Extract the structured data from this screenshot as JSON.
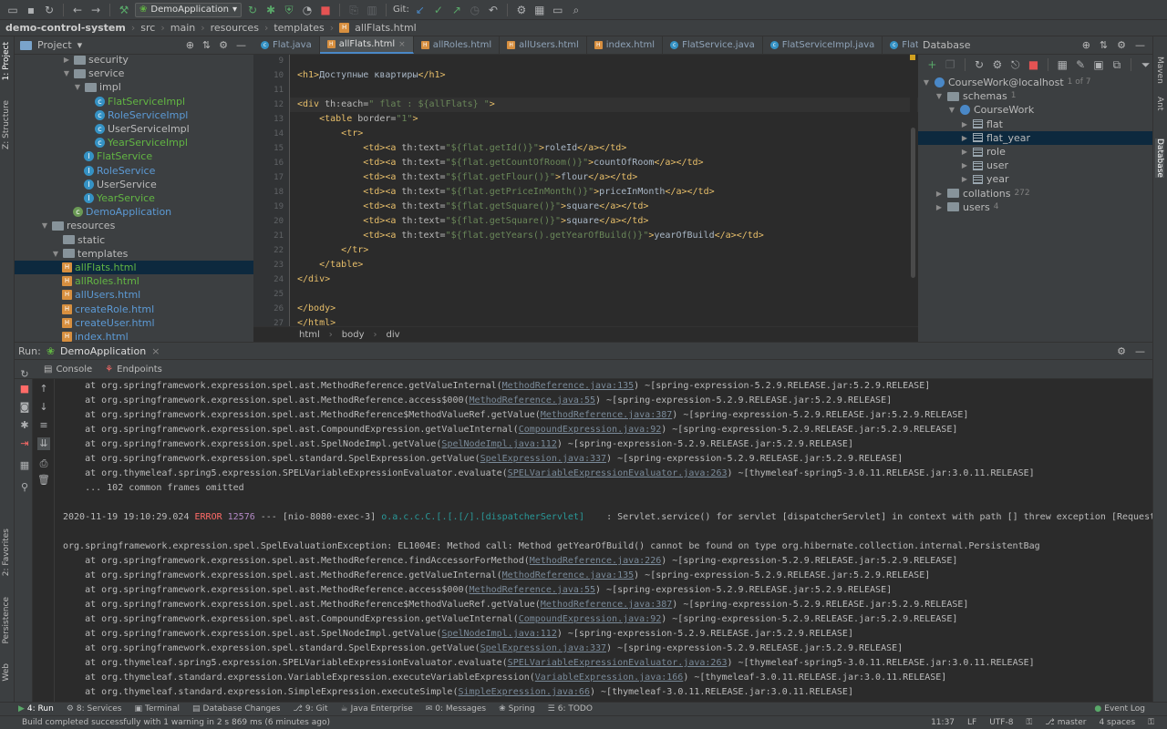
{
  "toolbar": {
    "run_config": "DemoApplication",
    "git_label": "Git:"
  },
  "breadcrumbs": [
    "demo-control-system",
    "src",
    "main",
    "resources",
    "templates",
    "allFlats.html"
  ],
  "left_strip": {
    "project": "1: Project",
    "structure": "Z: Structure",
    "favorites": "2: Favorites",
    "persistence": "Persistence",
    "web": "Web"
  },
  "right_strip": {
    "maven": "Maven",
    "ant": "Ant",
    "database": "Database"
  },
  "project": {
    "title": "Project",
    "tree": [
      {
        "label": "security",
        "kind": "folder",
        "indent": 4,
        "arrow": "▶"
      },
      {
        "label": "service",
        "kind": "folder",
        "indent": 4,
        "arrow": "▼"
      },
      {
        "label": "impl",
        "kind": "folder",
        "indent": 5,
        "arrow": "▼"
      },
      {
        "label": "FlatServiceImpl",
        "kind": "class",
        "indent": 7,
        "color": "g"
      },
      {
        "label": "RoleServiceImpl",
        "kind": "class",
        "indent": 7,
        "color": "b"
      },
      {
        "label": "UserServiceImpl",
        "kind": "class",
        "indent": 7,
        "color": ""
      },
      {
        "label": "YearServiceImpl",
        "kind": "class",
        "indent": 7,
        "color": "g"
      },
      {
        "label": "FlatService",
        "kind": "iface",
        "indent": 6,
        "color": "g"
      },
      {
        "label": "RoleService",
        "kind": "iface",
        "indent": 6,
        "color": "b"
      },
      {
        "label": "UserService",
        "kind": "iface",
        "indent": 6,
        "color": ""
      },
      {
        "label": "YearService",
        "kind": "iface",
        "indent": 6,
        "color": "g"
      },
      {
        "label": "DemoApplication",
        "kind": "spring",
        "indent": 5,
        "color": "b"
      },
      {
        "label": "resources",
        "kind": "folder",
        "indent": 2,
        "arrow": "▼"
      },
      {
        "label": "static",
        "kind": "folder",
        "indent": 3,
        "arrow": ""
      },
      {
        "label": "templates",
        "kind": "folder",
        "indent": 3,
        "arrow": "▼"
      },
      {
        "label": "allFlats.html",
        "kind": "html",
        "indent": 4,
        "color": "g",
        "selected": true
      },
      {
        "label": "allRoles.html",
        "kind": "html",
        "indent": 4,
        "color": "g"
      },
      {
        "label": "allUsers.html",
        "kind": "html",
        "indent": 4,
        "color": "b"
      },
      {
        "label": "createRole.html",
        "kind": "html",
        "indent": 4,
        "color": "b"
      },
      {
        "label": "createUser.html",
        "kind": "html",
        "indent": 4,
        "color": "b"
      },
      {
        "label": "index.html",
        "kind": "html",
        "indent": 4,
        "color": "b"
      }
    ]
  },
  "editor_tabs": [
    {
      "label": "Flat.java",
      "type": "class"
    },
    {
      "label": "allFlats.html",
      "type": "html",
      "active": true
    },
    {
      "label": "allRoles.html",
      "type": "html"
    },
    {
      "label": "allUsers.html",
      "type": "html"
    },
    {
      "label": "index.html",
      "type": "html"
    },
    {
      "label": "FlatService.java",
      "type": "class"
    },
    {
      "label": "FlatServiceImpl.java",
      "type": "class"
    },
    {
      "label": "FlatController.ja",
      "type": "class"
    }
  ],
  "editor": {
    "lines": [
      {
        "n": "9",
        "html": ""
      },
      {
        "n": "10",
        "html": "<span class=\"tg\">&lt;h1&gt;</span>Доступные квартиры<span class=\"tg\">&lt;/h1&gt;</span>"
      },
      {
        "n": "11",
        "html": ""
      },
      {
        "n": "12",
        "html": "<span class=\"tg\">&lt;div </span><span class=\"at\">th:each=</span><span class=\"av\">\" flat : ${allFlats} \"</span><span class=\"tg\">&gt;</span>",
        "current": true
      },
      {
        "n": "13",
        "html": "    <span class=\"tg\">&lt;table </span><span class=\"at\">border=</span><span class=\"av\">\"1\"</span><span class=\"tg\">&gt;</span>"
      },
      {
        "n": "14",
        "html": "        <span class=\"tg\">&lt;tr&gt;</span>"
      },
      {
        "n": "15",
        "html": "            <span class=\"tg\">&lt;td&gt;&lt;a </span><span class=\"at\">th:text=</span><span class=\"av\">\"${flat.getId()}\"</span><span class=\"tg\">&gt;</span>roleId<span class=\"tg\">&lt;/a&gt;&lt;/td&gt;</span>"
      },
      {
        "n": "16",
        "html": "            <span class=\"tg\">&lt;td&gt;&lt;a </span><span class=\"at\">th:text=</span><span class=\"av\">\"${flat.getCountOfRoom()}\"</span><span class=\"tg\">&gt;</span>countOfRoom<span class=\"tg\">&lt;/a&gt;&lt;/td&gt;</span>"
      },
      {
        "n": "17",
        "html": "            <span class=\"tg\">&lt;td&gt;&lt;a </span><span class=\"at\">th:text=</span><span class=\"av\">\"${flat.getFlour()}\"</span><span class=\"tg\">&gt;</span>flour<span class=\"tg\">&lt;/a&gt;&lt;/td&gt;</span>"
      },
      {
        "n": "18",
        "html": "            <span class=\"tg\">&lt;td&gt;&lt;a </span><span class=\"at\">th:text=</span><span class=\"av\">\"${flat.getPriceInMonth()}\"</span><span class=\"tg\">&gt;</span>priceInMonth<span class=\"tg\">&lt;/a&gt;&lt;/td&gt;</span>"
      },
      {
        "n": "19",
        "html": "            <span class=\"tg\">&lt;td&gt;&lt;a </span><span class=\"at\">th:text=</span><span class=\"av\">\"${flat.getSquare()}\"</span><span class=\"tg\">&gt;</span>square<span class=\"tg\">&lt;/a&gt;&lt;/td&gt;</span>"
      },
      {
        "n": "20",
        "html": "            <span class=\"tg\">&lt;td&gt;&lt;a </span><span class=\"at\">th:text=</span><span class=\"av\">\"${flat.getSquare()}\"</span><span class=\"tg\">&gt;</span>square<span class=\"tg\">&lt;/a&gt;&lt;/td&gt;</span>"
      },
      {
        "n": "21",
        "html": "            <span class=\"tg\">&lt;td&gt;&lt;a </span><span class=\"at\">th:text=</span><span class=\"av\">\"${flat.getYears().getYearOfBuild()}\"</span><span class=\"tg\">&gt;</span>yearOfBuild<span class=\"tg\">&lt;/a&gt;&lt;/td&gt;</span>"
      },
      {
        "n": "22",
        "html": "        <span class=\"tg\">&lt;/tr&gt;</span>"
      },
      {
        "n": "23",
        "html": "    <span class=\"tg\">&lt;/table&gt;</span>"
      },
      {
        "n": "24",
        "html": "<span class=\"tg\">&lt;/div&gt;</span>"
      },
      {
        "n": "25",
        "html": ""
      },
      {
        "n": "26",
        "html": "<span class=\"tg\">&lt;/body&gt;</span>"
      },
      {
        "n": "27",
        "html": "<span class=\"tg\">&lt;/html&gt;</span>"
      }
    ],
    "path": [
      "html",
      "body",
      "div"
    ]
  },
  "database": {
    "title": "Database",
    "tree": [
      {
        "label": "CourseWork@localhost",
        "count": "1 of 7",
        "kind": "db",
        "indent": 0,
        "arrow": "▼"
      },
      {
        "label": "schemas",
        "count": "1",
        "kind": "folder",
        "indent": 1,
        "arrow": "▼"
      },
      {
        "label": "CourseWork",
        "count": "",
        "kind": "schema",
        "indent": 2,
        "arrow": "▼"
      },
      {
        "label": "flat",
        "count": "",
        "kind": "table",
        "indent": 3,
        "arrow": "▶"
      },
      {
        "label": "flat_year",
        "count": "",
        "kind": "table",
        "indent": 3,
        "arrow": "▶",
        "selected": true
      },
      {
        "label": "role",
        "count": "",
        "kind": "table",
        "indent": 3,
        "arrow": "▶"
      },
      {
        "label": "user",
        "count": "",
        "kind": "table",
        "indent": 3,
        "arrow": "▶"
      },
      {
        "label": "year",
        "count": "",
        "kind": "table",
        "indent": 3,
        "arrow": "▶"
      },
      {
        "label": "collations",
        "count": "272",
        "kind": "folder",
        "indent": 1,
        "arrow": "▶"
      },
      {
        "label": "users",
        "count": "4",
        "kind": "folder",
        "indent": 1,
        "arrow": "▶"
      }
    ]
  },
  "run": {
    "label": "Run:",
    "config": "DemoApplication",
    "tabs": [
      "Console",
      "Endpoints"
    ]
  },
  "console": {
    "lines": [
      {
        "pre": "    at org.springframework.expression.spel.ast.MethodReference.getValueInternal(",
        "link": "MethodReference.java:135",
        "post": ") ~[spring-expression-5.2.9.RELEASE.jar:5.2.9.RELEASE]"
      },
      {
        "pre": "    at org.springframework.expression.spel.ast.MethodReference.access$000(",
        "link": "MethodReference.java:55",
        "post": ") ~[spring-expression-5.2.9.RELEASE.jar:5.2.9.RELEASE]"
      },
      {
        "pre": "    at org.springframework.expression.spel.ast.MethodReference$MethodValueRef.getValue(",
        "link": "MethodReference.java:387",
        "post": ") ~[spring-expression-5.2.9.RELEASE.jar:5.2.9.RELEASE]"
      },
      {
        "pre": "    at org.springframework.expression.spel.ast.CompoundExpression.getValueInternal(",
        "link": "CompoundExpression.java:92",
        "post": ") ~[spring-expression-5.2.9.RELEASE.jar:5.2.9.RELEASE]"
      },
      {
        "pre": "    at org.springframework.expression.spel.ast.SpelNodeImpl.getValue(",
        "link": "SpelNodeImpl.java:112",
        "post": ") ~[spring-expression-5.2.9.RELEASE.jar:5.2.9.RELEASE]"
      },
      {
        "pre": "    at org.springframework.expression.spel.standard.SpelExpression.getValue(",
        "link": "SpelExpression.java:337",
        "post": ") ~[spring-expression-5.2.9.RELEASE.jar:5.2.9.RELEASE]"
      },
      {
        "pre": "    at org.thymeleaf.spring5.expression.SPELVariableExpressionEvaluator.evaluate(",
        "link": "SPELVariableExpressionEvaluator.java:263",
        "post": ") ~[thymeleaf-spring5-3.0.11.RELEASE.jar:3.0.11.RELEASE]"
      },
      {
        "pre": "    ... 102 common frames omitted",
        "link": "",
        "post": ""
      },
      {
        "pre": "",
        "link": "",
        "post": ""
      },
      {
        "type": "log",
        "time": "2020-11-19 19:10:29.024",
        "level": "ERROR",
        "pid": "12576",
        "sep": " --- [nio-8080-exec-3] ",
        "cat": "o.a.c.c.C.[.[.[/].[dispatcherServlet]",
        "msg": "    : Servlet.service() for servlet [dispatcherServlet] in context with path [] threw exception [Request processing failed"
      },
      {
        "pre": "",
        "link": "",
        "post": ""
      },
      {
        "pre": "org.springframework.expression.spel.SpelEvaluationException: EL1004E: Method call: Method getYearOfBuild() cannot be found on type org.hibernate.collection.internal.PersistentBag",
        "link": "",
        "post": ""
      },
      {
        "pre": "    at org.springframework.expression.spel.ast.MethodReference.findAccessorForMethod(",
        "link": "MethodReference.java:226",
        "post": ") ~[spring-expression-5.2.9.RELEASE.jar:5.2.9.RELEASE]"
      },
      {
        "pre": "    at org.springframework.expression.spel.ast.MethodReference.getValueInternal(",
        "link": "MethodReference.java:135",
        "post": ") ~[spring-expression-5.2.9.RELEASE.jar:5.2.9.RELEASE]"
      },
      {
        "pre": "    at org.springframework.expression.spel.ast.MethodReference.access$000(",
        "link": "MethodReference.java:55",
        "post": ") ~[spring-expression-5.2.9.RELEASE.jar:5.2.9.RELEASE]"
      },
      {
        "pre": "    at org.springframework.expression.spel.ast.MethodReference$MethodValueRef.getValue(",
        "link": "MethodReference.java:387",
        "post": ") ~[spring-expression-5.2.9.RELEASE.jar:5.2.9.RELEASE]"
      },
      {
        "pre": "    at org.springframework.expression.spel.ast.CompoundExpression.getValueInternal(",
        "link": "CompoundExpression.java:92",
        "post": ") ~[spring-expression-5.2.9.RELEASE.jar:5.2.9.RELEASE]"
      },
      {
        "pre": "    at org.springframework.expression.spel.ast.SpelNodeImpl.getValue(",
        "link": "SpelNodeImpl.java:112",
        "post": ") ~[spring-expression-5.2.9.RELEASE.jar:5.2.9.RELEASE]"
      },
      {
        "pre": "    at org.springframework.expression.spel.standard.SpelExpression.getValue(",
        "link": "SpelExpression.java:337",
        "post": ") ~[spring-expression-5.2.9.RELEASE.jar:5.2.9.RELEASE]"
      },
      {
        "pre": "    at org.thymeleaf.spring5.expression.SPELVariableExpressionEvaluator.evaluate(",
        "link": "SPELVariableExpressionEvaluator.java:263",
        "post": ") ~[thymeleaf-spring5-3.0.11.RELEASE.jar:3.0.11.RELEASE]"
      },
      {
        "pre": "    at org.thymeleaf.standard.expression.VariableExpression.executeVariableExpression(",
        "link": "VariableExpression.java:166",
        "post": ") ~[thymeleaf-3.0.11.RELEASE.jar:3.0.11.RELEASE]"
      },
      {
        "pre": "    at org.thymeleaf.standard.expression.SimpleExpression.executeSimple(",
        "link": "SimpleExpression.java:66",
        "post": ") ~[thymeleaf-3.0.11.RELEASE.jar:3.0.11.RELEASE]"
      }
    ]
  },
  "bottom_tabs": [
    {
      "label": "4: Run",
      "icon": "▶"
    },
    {
      "label": "8: Services",
      "icon": "⚙"
    },
    {
      "label": "Terminal",
      "icon": "▣"
    },
    {
      "label": "Database Changes",
      "icon": "▤"
    },
    {
      "label": "9: Git",
      "icon": "⎇"
    },
    {
      "label": "Java Enterprise",
      "icon": "☕"
    },
    {
      "label": "0: Messages",
      "icon": "✉"
    },
    {
      "label": "Spring",
      "icon": "❀"
    },
    {
      "label": "6: TODO",
      "icon": "☰"
    }
  ],
  "event_log": "Event Log",
  "status": {
    "message": "Build completed successfully with 1 warning in 2 s 869 ms (6 minutes ago)",
    "position": "11:37",
    "line_sep": "LF",
    "encoding": "UTF-8",
    "branch": "master",
    "indent": "4 spaces"
  }
}
